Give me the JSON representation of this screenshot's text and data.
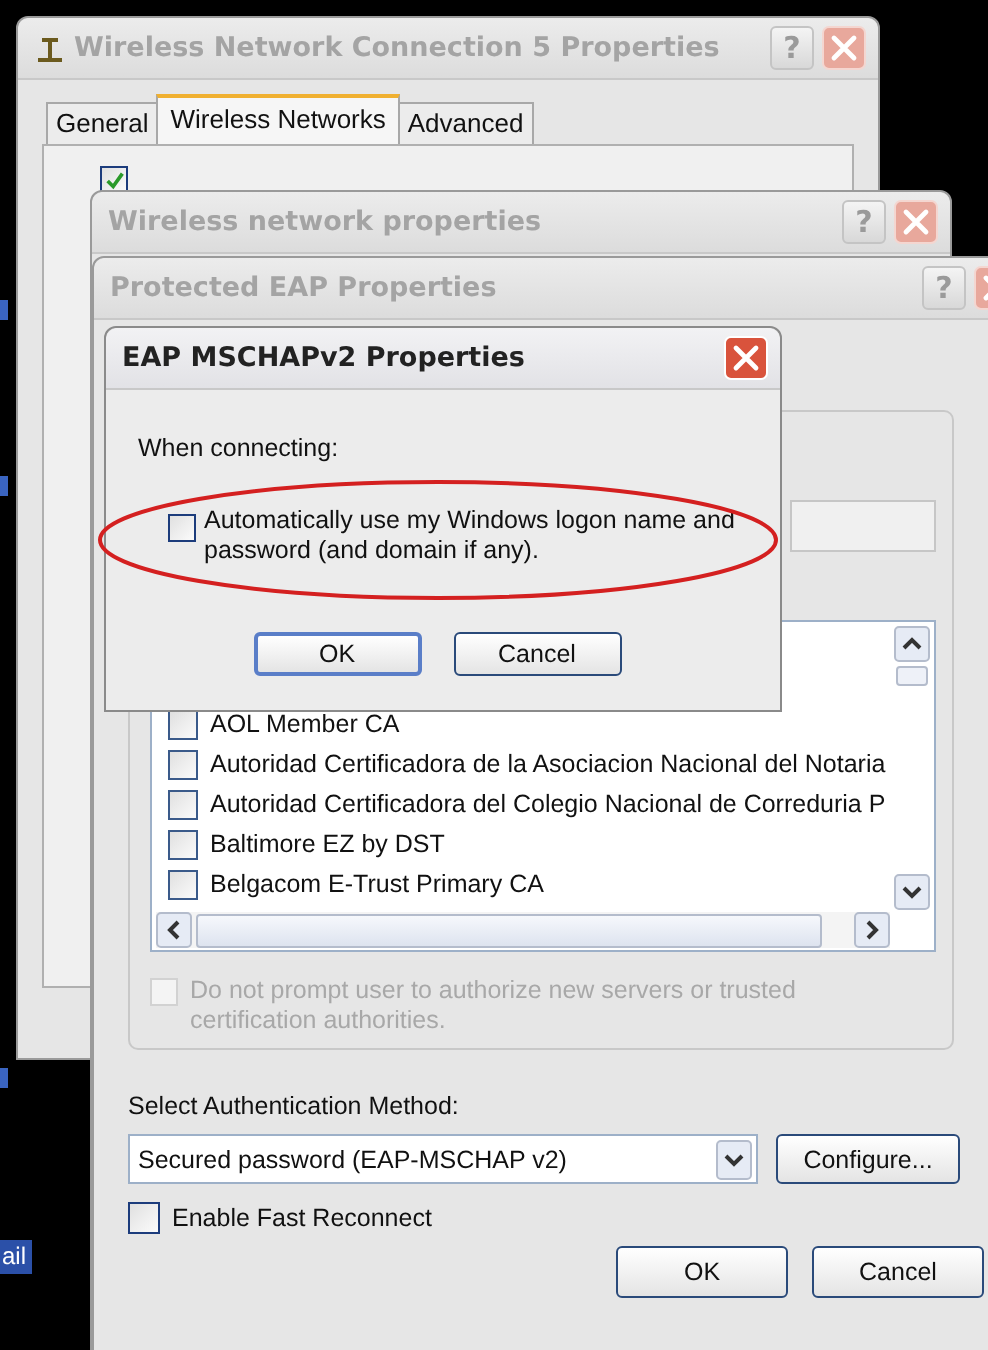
{
  "desktop": {
    "label": "ail"
  },
  "back_window": {
    "title": "Wireless Network Connection 5 Properties",
    "active": false,
    "help": "?",
    "tabs": [
      {
        "label": "General",
        "selected": false
      },
      {
        "label": "Wireless Networks",
        "selected": true
      },
      {
        "label": "Advanced",
        "selected": false
      }
    ],
    "checkbox": {
      "checked": true
    }
  },
  "middle_window": {
    "title": "Wireless network properties",
    "active": false,
    "help": "?"
  },
  "peap_window": {
    "title": "Protected EAP Properties",
    "active": false,
    "help": "?",
    "ca_list": [
      {
        "label": "AOL Member CA",
        "checked": false
      },
      {
        "label": "Autoridad Certificadora de la Asociacion Nacional del Notaria",
        "checked": false
      },
      {
        "label": "Autoridad Certificadora del Colegio Nacional de Correduria P",
        "checked": false
      },
      {
        "label": "Baltimore EZ by DST",
        "checked": false
      },
      {
        "label": "Belgacom E-Trust Primary CA",
        "checked": false
      }
    ],
    "server_prompt": {
      "label": "Do not prompt user to authorize new servers or trusted certification authorities.",
      "checked": false,
      "disabled": true
    },
    "auth_method": {
      "label": "Select Authentication Method:",
      "value": "Secured password (EAP-MSCHAP v2)"
    },
    "configure_button": "Configure...",
    "fast_reconnect": {
      "label": "Enable Fast Reconnect",
      "checked": false
    },
    "buttons": [
      "OK",
      "Cancel"
    ]
  },
  "mschap_dialog": {
    "title": "EAP MSCHAPv2 Properties",
    "active": true,
    "prompt": "When connecting:",
    "auto_logon": {
      "label": "Automatically use my Windows logon name and password (and domain if any).",
      "checked": false
    },
    "buttons": [
      "OK",
      "Cancel"
    ]
  }
}
